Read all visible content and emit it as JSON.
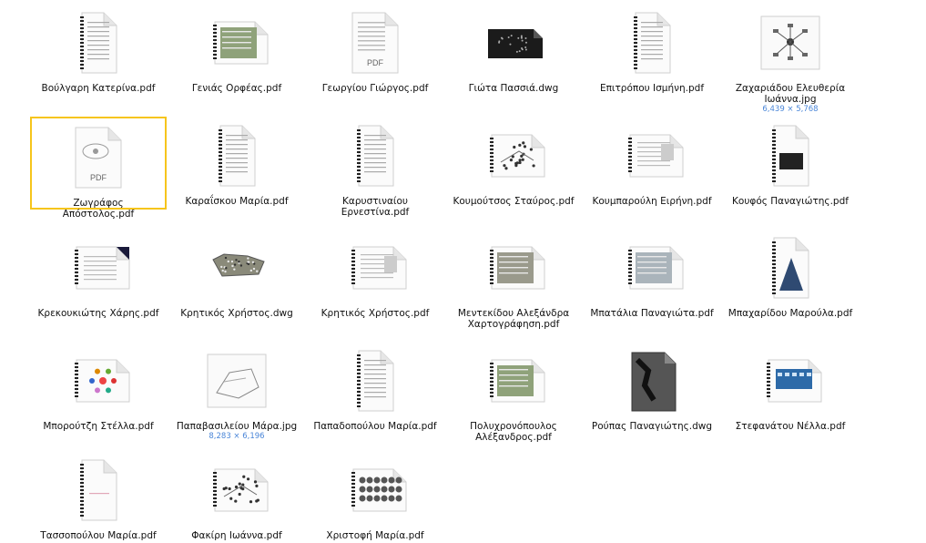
{
  "files": [
    {
      "name": "Βούλγαρη Κατερίνα.pdf",
      "icon": "doc-binder-icon"
    },
    {
      "name": "Γενιάς Ορφέας.pdf",
      "icon": "doc-landscape-green-icon"
    },
    {
      "name": "Γεωργίου Γιώργος.pdf",
      "icon": "pdf-text-icon",
      "badge": "PDF"
    },
    {
      "name": "Γιώτα Πασσιά.dwg",
      "icon": "dwg-dark-icon"
    },
    {
      "name": "Επιτρόπου Ισμήνη.pdf",
      "icon": "doc-binder-icon"
    },
    {
      "name": "Ζαχαριάδου Ελευθερία Ιωάννα.jpg",
      "icon": "image-diagram-icon",
      "sub": "6,439 × 5,768"
    },
    {
      "name": "Ζωγράφος Απόστολος.pdf",
      "icon": "pdf-diagram-icon",
      "badge": "PDF",
      "selected": true
    },
    {
      "name": "Καραΐσκου Μαρία.pdf",
      "icon": "doc-binder-icon"
    },
    {
      "name": "Καρυστιναίου Ερνεστίνα.pdf",
      "icon": "doc-binder-icon"
    },
    {
      "name": "Κουμούτσος Σταύρος.pdf",
      "icon": "doc-landscape-map-icon"
    },
    {
      "name": "Κουμπαρούλη Ειρήνη.pdf",
      "icon": "doc-landscape-icon"
    },
    {
      "name": "Κουφός Παναγιώτης.pdf",
      "icon": "doc-binder-dark-icon"
    },
    {
      "name": "Κρεκουκιώτης Χάρης.pdf",
      "icon": "doc-landscape-dark-corner-icon"
    },
    {
      "name": "Κρητικός Χρήστος.dwg",
      "icon": "dwg-map-icon"
    },
    {
      "name": "Κρητικός Χρήστος.pdf",
      "icon": "doc-landscape-icon"
    },
    {
      "name": "Μεντεκίδου Αλεξάνδρα Χαρτογράφηση.pdf",
      "icon": "doc-landscape-grey-icon"
    },
    {
      "name": "Μπατάλια Παναγιώτα.pdf",
      "icon": "doc-landscape-photo-icon"
    },
    {
      "name": "Μπαχαρίδου Μαρούλα.pdf",
      "icon": "doc-binder-pyramid-icon"
    },
    {
      "name": "Μπορούτζη Στέλλα.pdf",
      "icon": "doc-landscape-flower-icon"
    },
    {
      "name": "Παπαβασιλείου Μάρα.jpg",
      "icon": "image-plan-icon",
      "sub": "8,283 × 6,196"
    },
    {
      "name": "Παπαδοπούλου Μαρία.pdf",
      "icon": "doc-binder-icon"
    },
    {
      "name": "Πολυχρονόπουλος Αλέξανδρος.pdf",
      "icon": "doc-landscape-green-icon"
    },
    {
      "name": "Ρούπας Παναγιώτης.dwg",
      "icon": "dwg-grey-icon"
    },
    {
      "name": "Στεφανάτου Νέλλα.pdf",
      "icon": "doc-landscape-blue-icon"
    },
    {
      "name": "Τασσοπούλου Μαρία.pdf",
      "icon": "doc-binder-blank-icon"
    },
    {
      "name": "Φακίρη Ιωάννα.pdf",
      "icon": "doc-landscape-map-icon"
    },
    {
      "name": "Χριστοφή Μαρία.pdf",
      "icon": "doc-landscape-grid-icon"
    }
  ]
}
